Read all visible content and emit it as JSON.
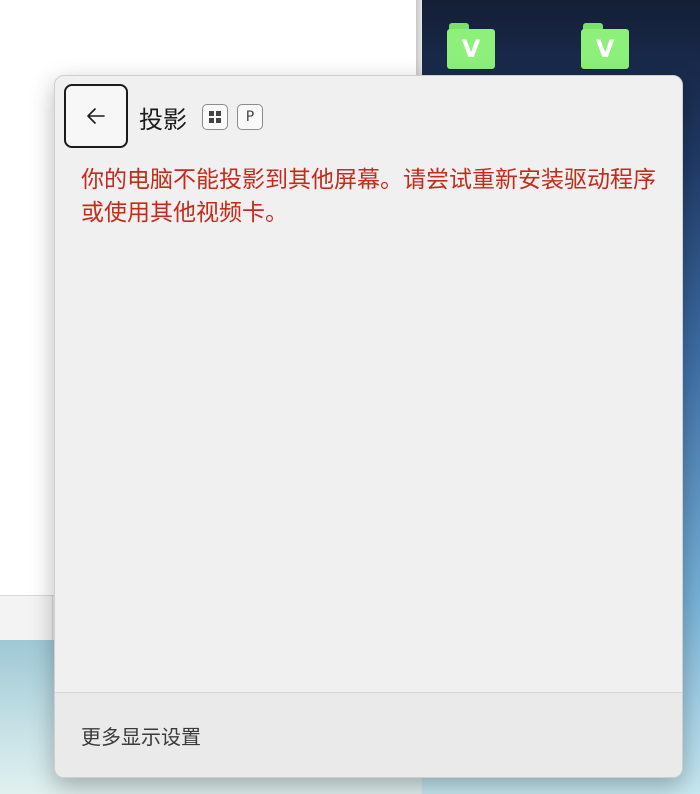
{
  "desktop": {
    "icons": [
      {
        "glyph": "V"
      },
      {
        "glyph": "V"
      }
    ]
  },
  "flyout": {
    "title": "投影",
    "shortcut": {
      "key_p": "P"
    },
    "error_message": "你的电脑不能投影到其他屏幕。请尝试重新安装驱动程序或使用其他视频卡。",
    "footer_link": "更多显示设置"
  },
  "colors": {
    "error_text": "#c42b1c",
    "folder_green": "#8df07a",
    "flyout_bg": "#f0f0f0"
  }
}
